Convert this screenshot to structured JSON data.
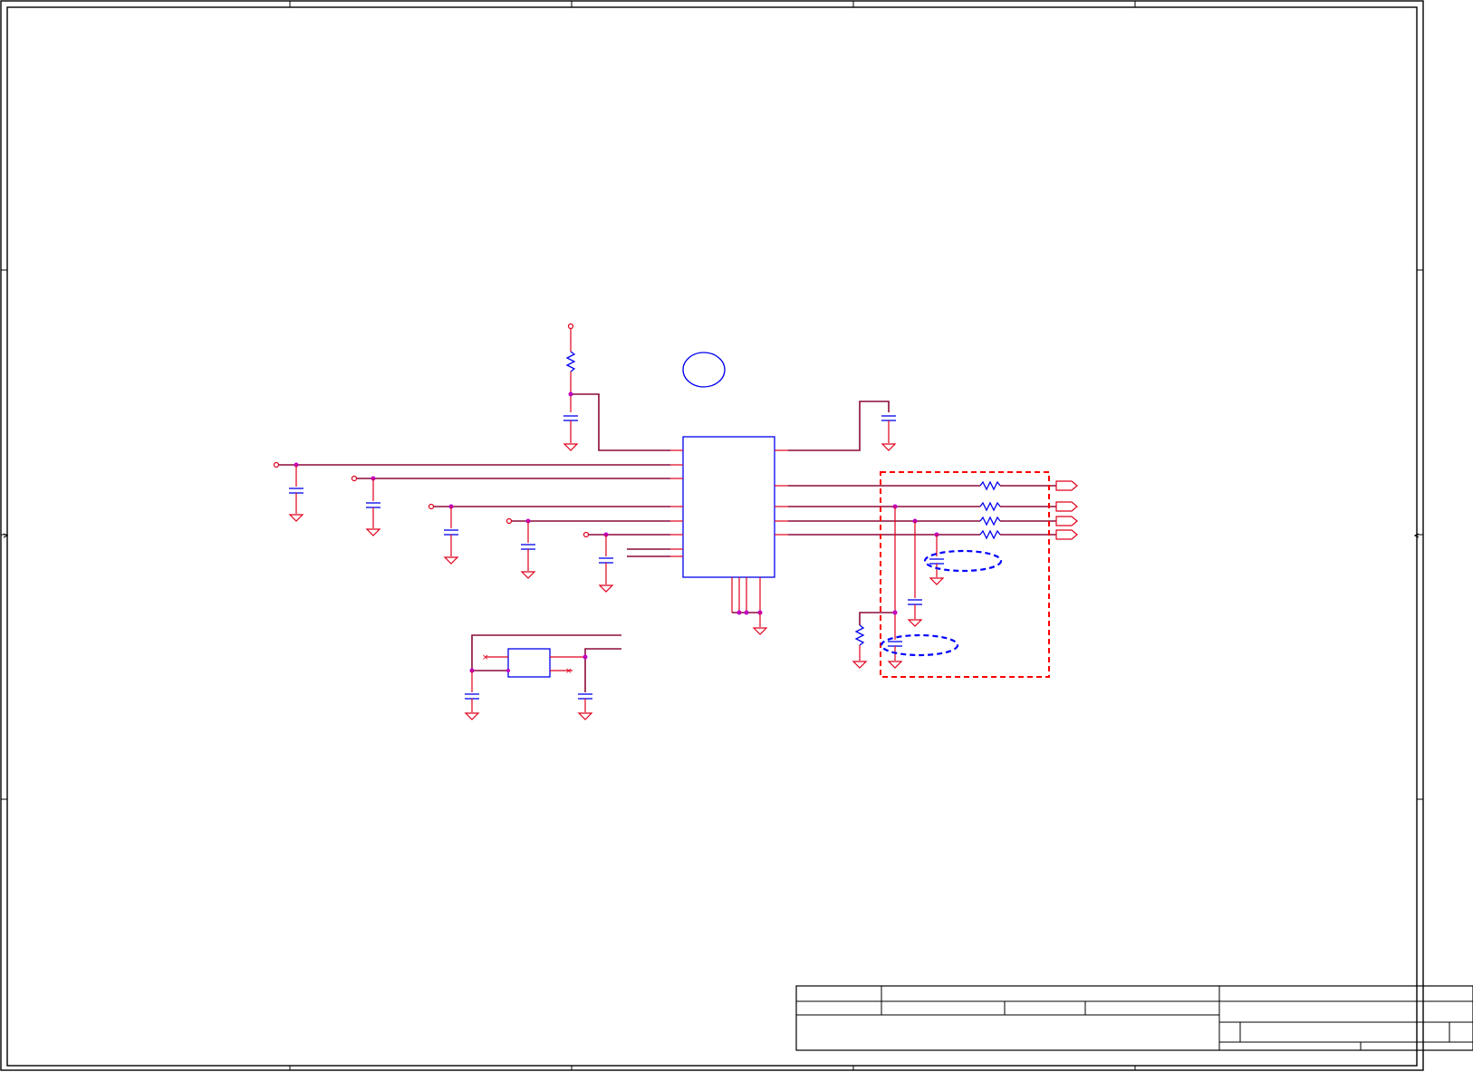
{
  "sheet": {
    "colors": {
      "frame": "#000000",
      "wire": "#8b0a3a",
      "pin": "#e0001b",
      "component": "#0000ee",
      "junction": "#c000c0",
      "highlight_red": "#ff0000",
      "highlight_blue": "#0000ff"
    },
    "icons": [
      "resistor-icon",
      "capacitor-icon",
      "ground-icon",
      "ic-chip-icon",
      "crystal-icon",
      "port-arrow-icon",
      "junction-dot-icon",
      "power-terminal-icon"
    ]
  }
}
